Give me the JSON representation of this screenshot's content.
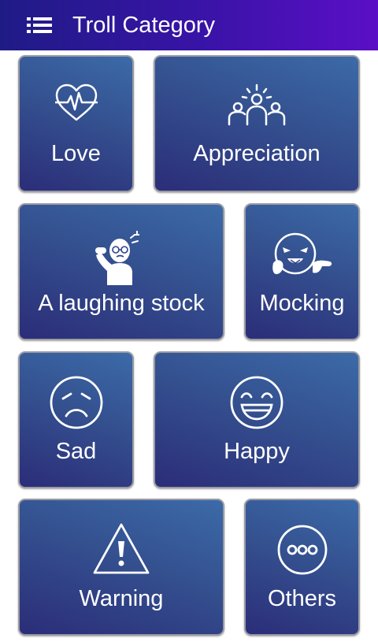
{
  "appbar": {
    "title": "Troll Category",
    "menu_icon": "hamburger-menu-icon",
    "gradient_start": "#1f1b86",
    "gradient_end": "#5b0fc6"
  },
  "tiles": [
    {
      "label": "Love",
      "icon": "heart-pulse-icon"
    },
    {
      "label": "Appreciation",
      "icon": "group-people-icon"
    },
    {
      "label": "A laughing stock",
      "icon": "head-scratching-man-icon"
    },
    {
      "label": "Mocking",
      "icon": "mocking-face-icon"
    },
    {
      "label": "Sad",
      "icon": "sad-face-icon"
    },
    {
      "label": "Happy",
      "icon": "happy-face-icon"
    },
    {
      "label": "Warning",
      "icon": "warning-triangle-icon"
    },
    {
      "label": "Others",
      "icon": "more-dots-icon"
    }
  ],
  "colors": {
    "tile_border": "#9a9aa4",
    "tile_fill": "#34508f",
    "text": "#ffffff"
  }
}
